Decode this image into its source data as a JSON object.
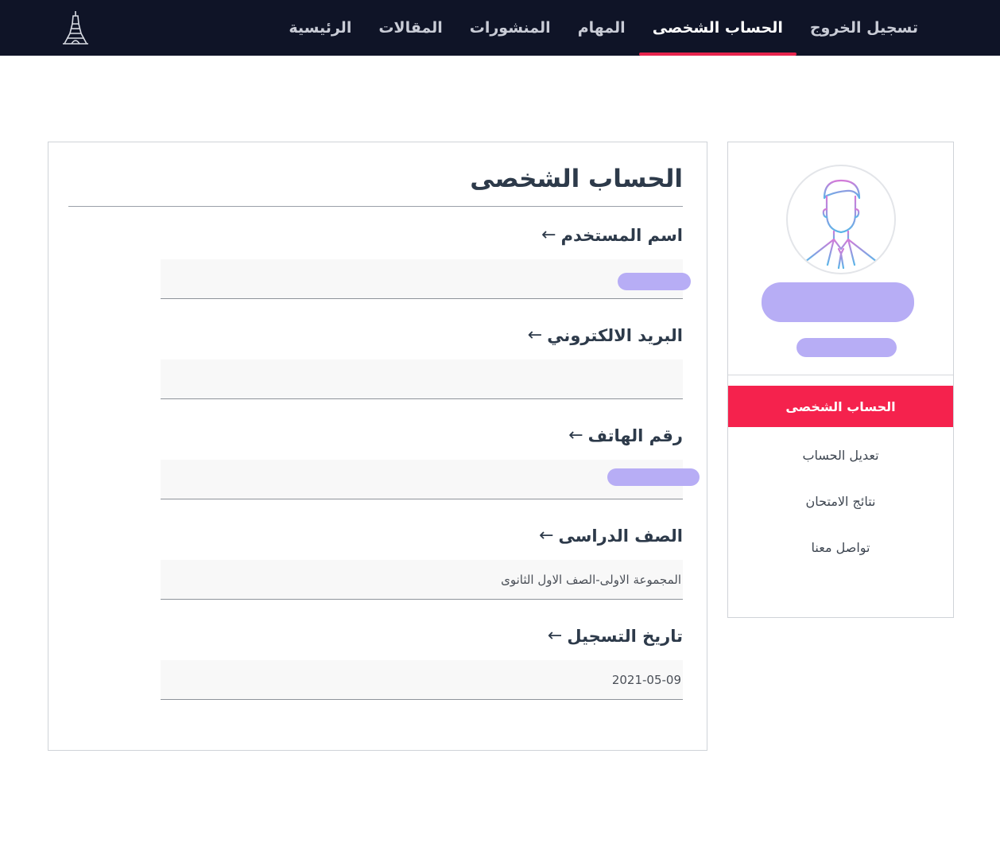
{
  "nav": {
    "items": [
      {
        "label": "الرئيسية",
        "active": false
      },
      {
        "label": "المقالات",
        "active": false
      },
      {
        "label": "المنشورات",
        "active": false
      },
      {
        "label": "المهام",
        "active": false
      },
      {
        "label": "الحساب الشخصى",
        "active": true
      },
      {
        "label": "تسجيل الخروج",
        "active": false
      }
    ],
    "logo_icon": "eiffel-tower-icon"
  },
  "sidebar": {
    "avatar_icon": "user-avatar-icon",
    "menu": [
      {
        "label": "الحساب الشخصى",
        "active": true
      },
      {
        "label": "تعديل الحساب",
        "active": false
      },
      {
        "label": "نتائج الامتحان",
        "active": false
      },
      {
        "label": "تواصل معنا",
        "active": false
      }
    ]
  },
  "profile": {
    "title": "الحساب الشخصى",
    "arrow": "←",
    "fields": [
      {
        "label": "اسم المستخدم",
        "value": ""
      },
      {
        "label": "البريد الالكتروني",
        "value": ""
      },
      {
        "label": "رقم الهاتف",
        "value": ""
      },
      {
        "label": "الصف الدراسى",
        "value": "المجموعة الاولى-الصف الاول الثانوى"
      },
      {
        "label": "تاريخ التسجيل",
        "value": "2021-05-09"
      }
    ]
  },
  "colors": {
    "topbar": "#0f1427",
    "accent": "#f5224d",
    "redaction": "#b7adf5"
  }
}
